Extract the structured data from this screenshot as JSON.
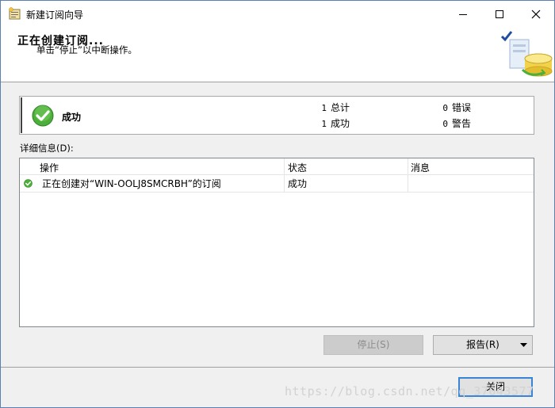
{
  "window": {
    "title": "新建订阅向导"
  },
  "header": {
    "title": "正在创建订阅...",
    "subtitle": "单击“停止”以中断操作。"
  },
  "summary": {
    "status": "成功",
    "stats": [
      {
        "count": "1",
        "label": "总计"
      },
      {
        "count": "0",
        "label": "错误"
      },
      {
        "count": "1",
        "label": "成功"
      },
      {
        "count": "0",
        "label": "警告"
      }
    ]
  },
  "details": {
    "label": "详细信息(D):",
    "columns": [
      "操作",
      "状态",
      "消息"
    ],
    "rows": [
      {
        "action": "正在创建对“WIN-OOLJ8SMCRBH”的订阅",
        "status": "成功",
        "message": ""
      }
    ]
  },
  "buttons": {
    "stop": "停止(S)",
    "report": "报告(R)",
    "close": "关闭"
  },
  "watermark": "https://blog.csdn.net/qq_37043577",
  "colors": {
    "success_green": "#4caf3a",
    "default_button_border": "#3a84d6"
  }
}
